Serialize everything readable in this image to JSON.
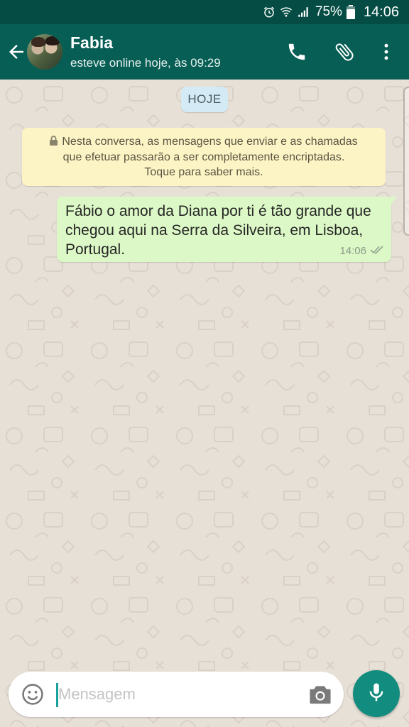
{
  "status_bar": {
    "battery_percent": "75%",
    "time": "14:06",
    "icons": [
      "alarm-icon",
      "wifi-icon",
      "signal-icon",
      "battery-icon"
    ]
  },
  "header": {
    "contact_name": "Fabia",
    "last_seen": "esteve online hoje, às 09:29",
    "icons": [
      "back-arrow-icon",
      "phone-icon",
      "paperclip-icon",
      "more-vert-icon"
    ]
  },
  "chat": {
    "date_label": "HOJE",
    "encryption_notice": {
      "line1": "Nesta conversa, as mensagens que enviar e as chamadas",
      "line2": "que efetuar passarão a ser completamente encriptadas.",
      "line3": "Toque para saber mais."
    },
    "messages": [
      {
        "direction": "outgoing",
        "text": "Fábio o amor da Diana por ti é tão grande que chegou aqui na Serra da Silveira, em Lisboa, Portugal.",
        "time": "14:06",
        "status": "delivered"
      }
    ]
  },
  "input": {
    "placeholder": "Mensagem",
    "value": ""
  },
  "colors": {
    "header": "#075e54",
    "status_bar": "#054d44",
    "outgoing_bubble": "#dcf8c6",
    "notice_bg": "#fdf4c5",
    "date_chip": "#d4eaf4",
    "accent": "#128c7e",
    "chat_bg": "#e7e0d7"
  }
}
